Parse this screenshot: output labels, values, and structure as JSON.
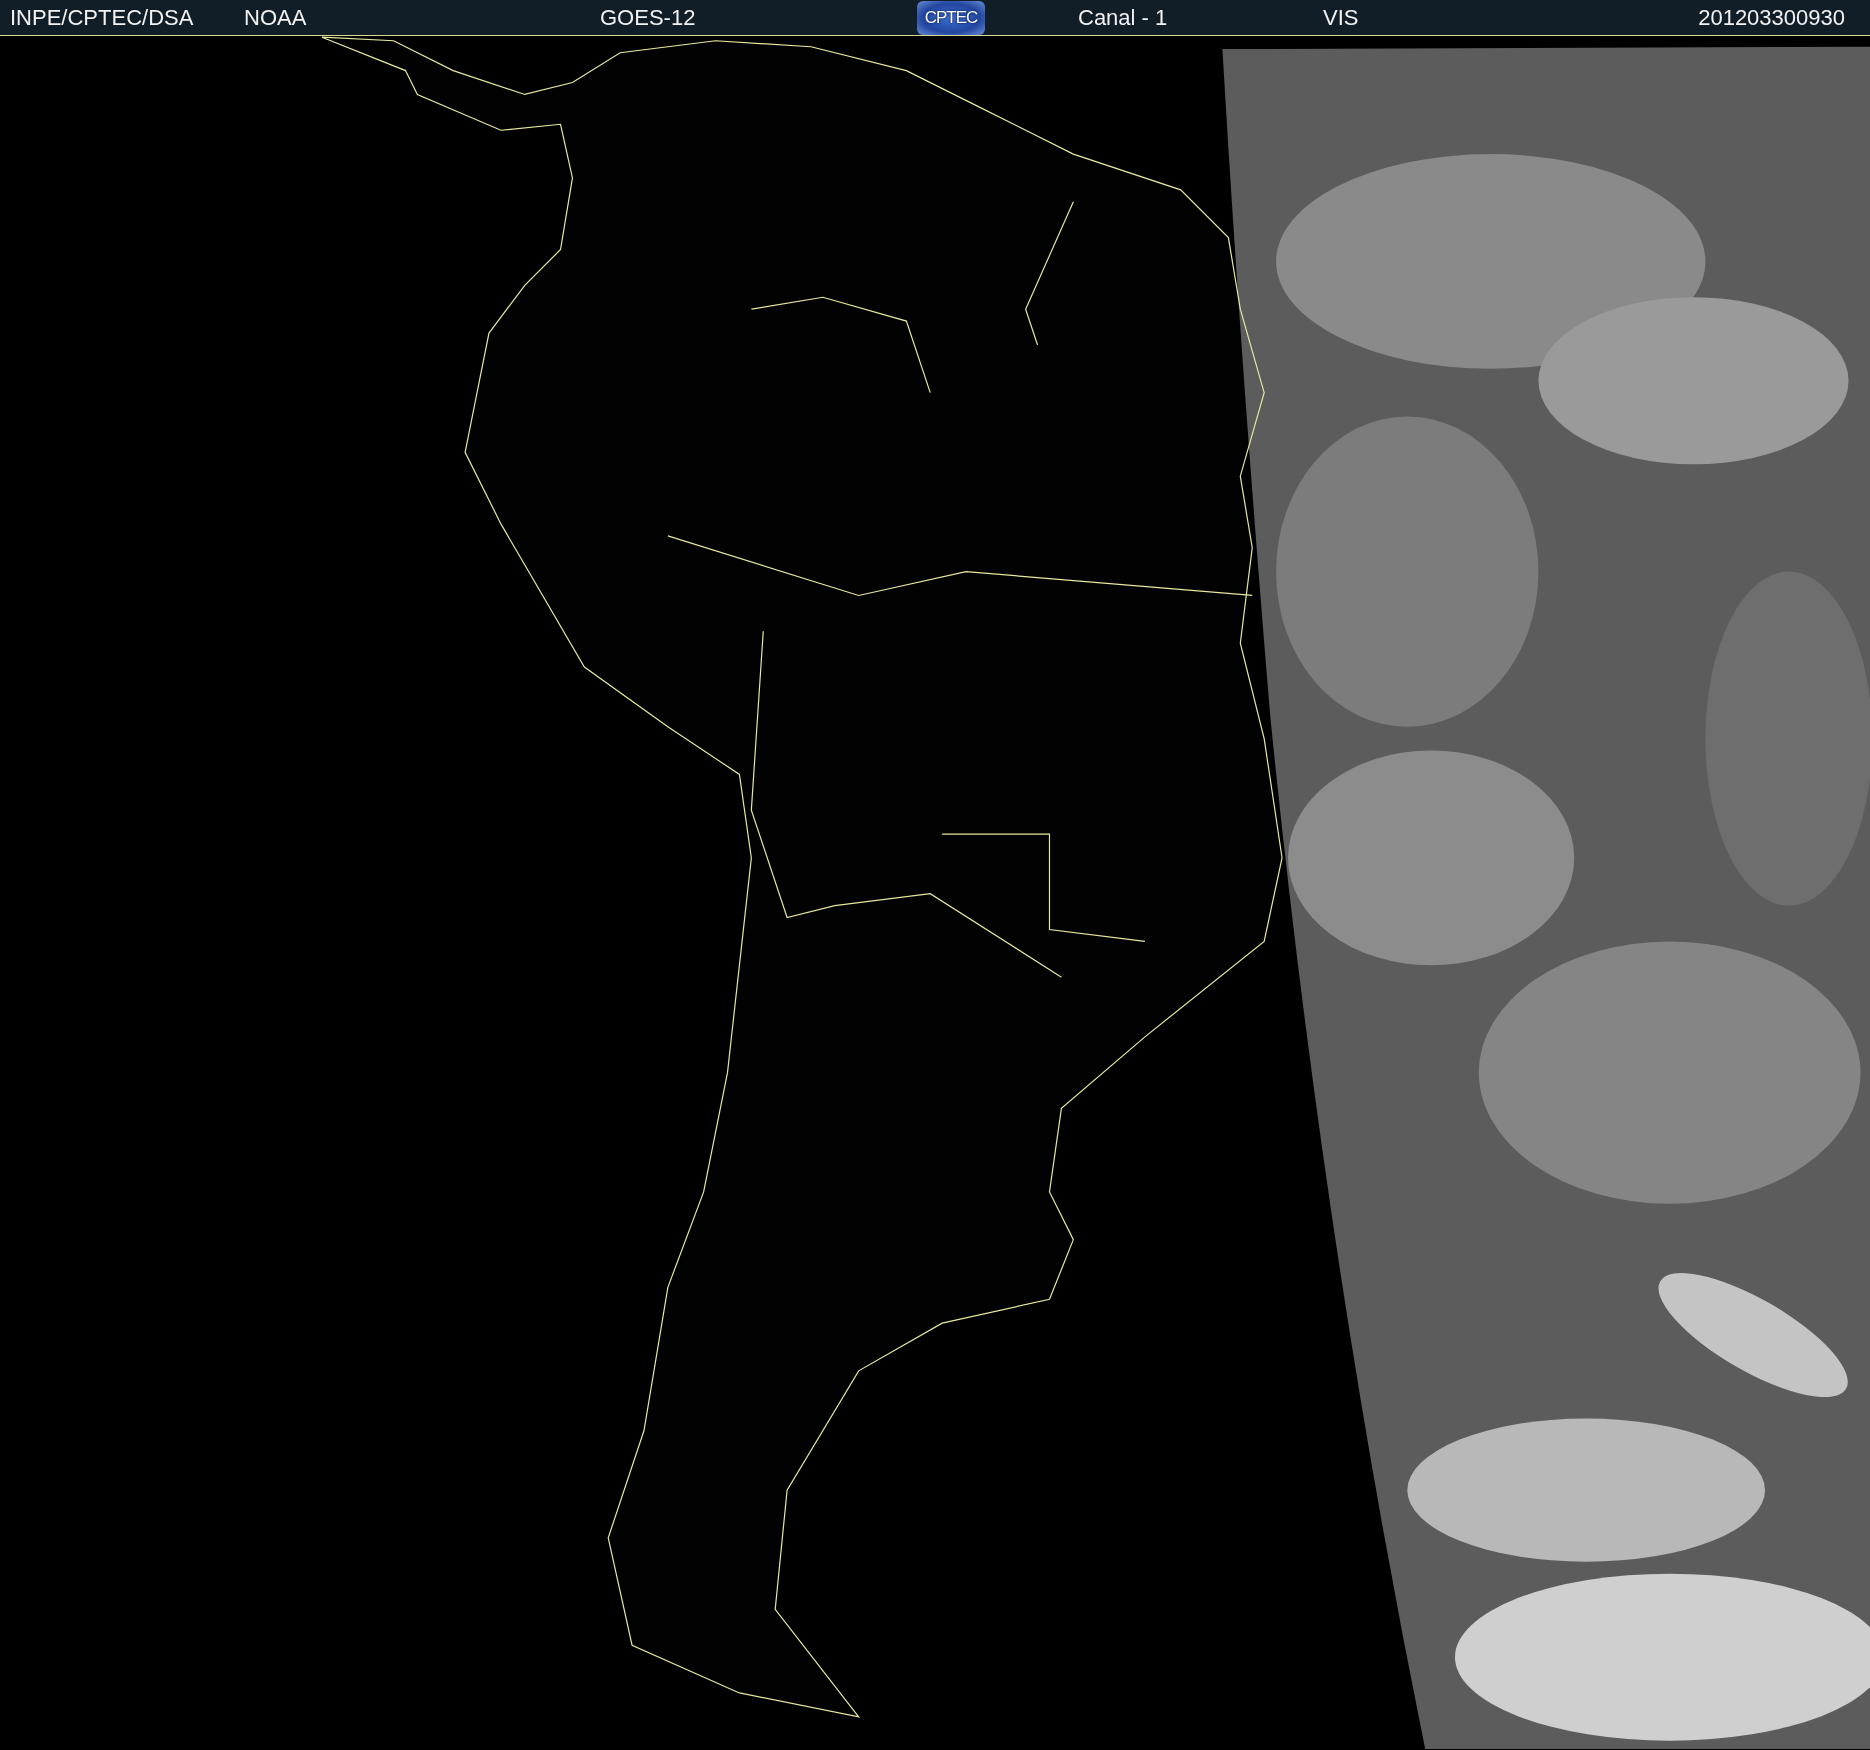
{
  "header": {
    "source": "INPE/CPTEC/DSA",
    "agency": "NOAA",
    "satellite": "GOES-12",
    "logo": "CPTEC",
    "channel": "Canal - 1",
    "band": "VIS",
    "timestamp": "201203300930"
  }
}
